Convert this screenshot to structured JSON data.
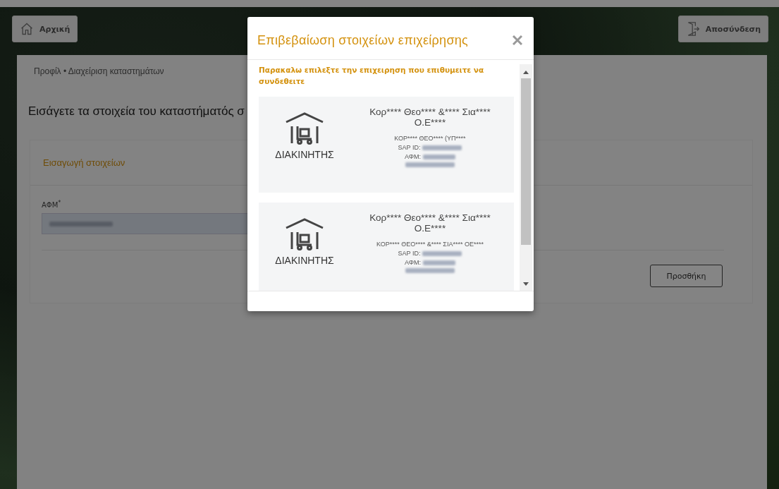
{
  "top_bar": {
    "home_button": "Αρχική",
    "logout_button": "Αποσύνδεση"
  },
  "breadcrumb": "Προφίλ • Διαχείριση καταστημάτων",
  "heading": "Εισάγετε τα στοιχεία του καταστήματός σ",
  "form": {
    "title": "Εισαγωγή στοιχείων",
    "field_label": "ΑΦΜ",
    "required_mark": "*",
    "submit_button": "Προσθήκη"
  },
  "dialog": {
    "title": "Επιβεβαίωση στοιχείων επιχείρησης",
    "instruction": "Παρακαλω επιλεξτε την επιχειρηση που επιθυμειτε να συνδεθειτε",
    "businesses": [
      {
        "role": "ΔΙΑΚΙΝΗΤΗΣ",
        "name": "Κορ**** Θεο**** &**** Σια**** Ο.Ε****",
        "legal_name": "ΚΟΡ**** ΘΕΟ**** (ΥΠ****",
        "sap_label": "SAP ID:",
        "tax_label": "ΑΦΜ:"
      },
      {
        "role": "ΔΙΑΚΙΝΗΤΗΣ",
        "name": "Κορ**** Θεο**** &**** Σια**** Ο.Ε****",
        "legal_name": "ΚΟΡ**** ΘΕΟ**** &**** ΣΙΑ**** ΟΕ****",
        "sap_label": "SAP ID:",
        "tax_label": "ΑΦΜ:"
      }
    ]
  }
}
